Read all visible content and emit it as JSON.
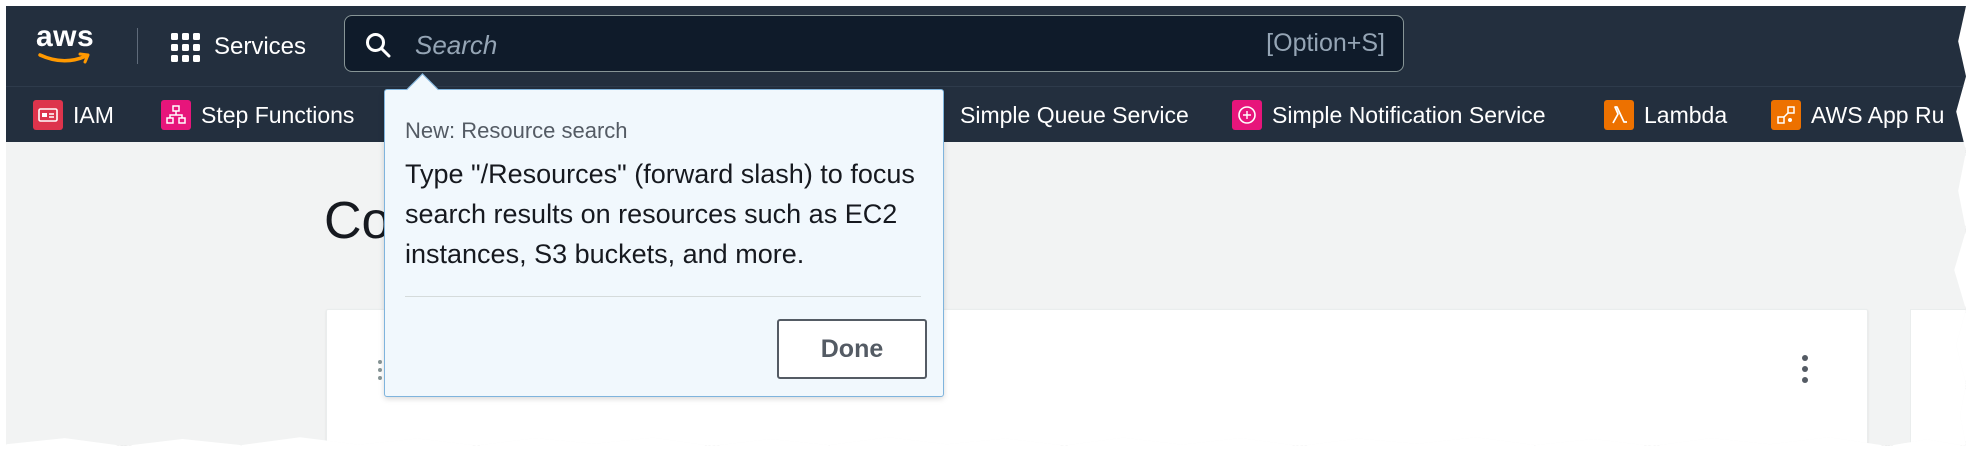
{
  "colors": {
    "nav_bg": "#232f3e",
    "search_bg": "#0f1b2a",
    "popover_bg": "#f1f8fd",
    "popover_border": "#7fb4dd",
    "page_bg": "#f2f3f3"
  },
  "header": {
    "logo_text": "aws",
    "services_label": "Services",
    "services_icon": "grid-icon",
    "search": {
      "placeholder": "Search",
      "shortcut": "[Option+S]",
      "icon": "search-icon"
    }
  },
  "favorites": [
    {
      "label": "IAM",
      "color": "#dd344c",
      "icon": "iam-icon"
    },
    {
      "label": "Step Functions",
      "color": "#e7157b",
      "icon": "step-functions-icon"
    },
    {
      "label": "Simple Queue Service",
      "color": "#e7157b",
      "icon": "sqs-icon"
    },
    {
      "label": "Simple Notification Service",
      "color": "#e7157b",
      "icon": "sns-icon"
    },
    {
      "label": "Lambda",
      "color": "#ed7100",
      "icon": "lambda-icon"
    },
    {
      "label": "AWS App Ru",
      "color": "#ed7100",
      "icon": "app-runner-icon"
    }
  ],
  "main": {
    "page_title": "Co"
  },
  "popover": {
    "header": "New: Resource search",
    "body": "Type \"/Resources\" (forward slash) to focus search results on resources such as EC2 instances, S3 buckets, and more.",
    "done_label": "Done"
  }
}
